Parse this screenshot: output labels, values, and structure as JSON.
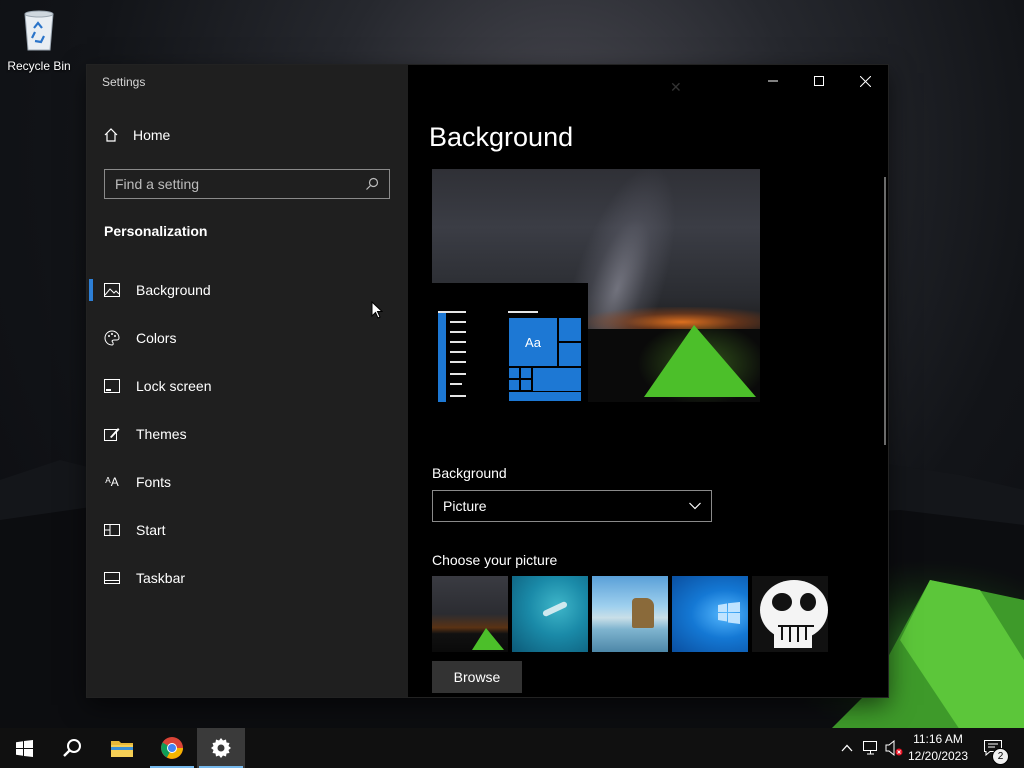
{
  "desktop": {
    "recycle_bin_label": "Recycle Bin"
  },
  "window": {
    "title": "Settings",
    "home_label": "Home",
    "search_placeholder": "Find a setting",
    "section_title": "Personalization",
    "nav": [
      {
        "label": "Background",
        "icon": "picture-icon",
        "active": true
      },
      {
        "label": "Colors",
        "icon": "palette-icon"
      },
      {
        "label": "Lock screen",
        "icon": "lock-screen-icon"
      },
      {
        "label": "Themes",
        "icon": "themes-icon"
      },
      {
        "label": "Fonts",
        "icon": "fonts-icon"
      },
      {
        "label": "Start",
        "icon": "start-icon"
      },
      {
        "label": "Taskbar",
        "icon": "taskbar-icon"
      }
    ]
  },
  "background_page": {
    "title": "Background",
    "preview_tile_text": "Aa",
    "background_label": "Background",
    "background_value": "Picture",
    "choose_label": "Choose your picture",
    "pictures": [
      "Night sky tent",
      "Underwater swimmer",
      "Beach rock arch",
      "Windows blue",
      "Skull"
    ],
    "browse_label": "Browse"
  },
  "taskbar": {
    "apps": [
      "start-icon",
      "search-icon",
      "file-explorer-icon",
      "chrome-icon",
      "settings-icon"
    ],
    "time": "11:16 AM",
    "date": "12/20/2023",
    "notification_count": "2"
  },
  "colors": {
    "accent": "#1d78d4",
    "taskbar_indicator": "#76b9ed"
  }
}
